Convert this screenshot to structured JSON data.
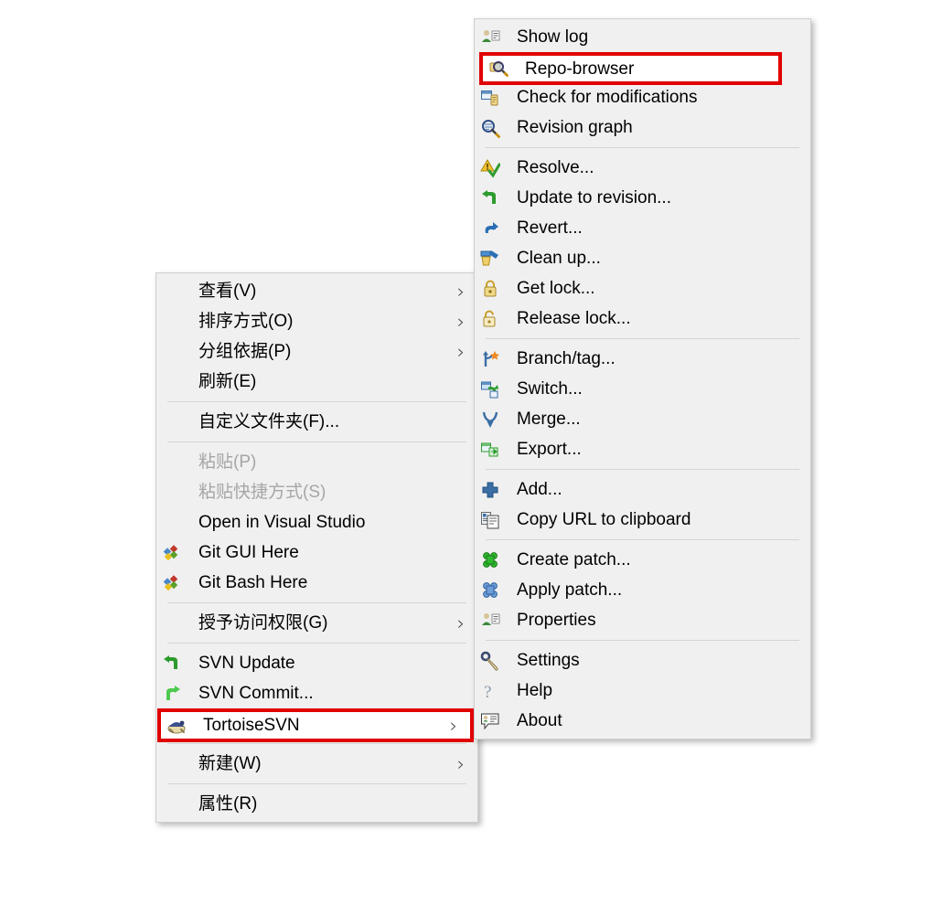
{
  "explorer_context_menu": {
    "name": "Windows Explorer context menu",
    "groups": [
      {
        "items": [
          {
            "label": "查看(V)",
            "icon": "none",
            "submenu": true,
            "disabled": false
          },
          {
            "label": "排序方式(O)",
            "icon": "none",
            "submenu": true,
            "disabled": false
          },
          {
            "label": "分组依据(P)",
            "icon": "none",
            "submenu": true,
            "disabled": false
          },
          {
            "label": "刷新(E)",
            "icon": "none",
            "submenu": false,
            "disabled": false
          }
        ]
      },
      {
        "items": [
          {
            "label": "自定义文件夹(F)...",
            "icon": "none",
            "submenu": false,
            "disabled": false
          }
        ]
      },
      {
        "items": [
          {
            "label": "粘贴(P)",
            "icon": "none",
            "submenu": false,
            "disabled": true
          },
          {
            "label": "粘贴快捷方式(S)",
            "icon": "none",
            "submenu": false,
            "disabled": true
          },
          {
            "label": "Open in Visual Studio",
            "icon": "none",
            "submenu": false,
            "disabled": false
          },
          {
            "label": "Git GUI Here",
            "icon": "git-icon",
            "submenu": false,
            "disabled": false
          },
          {
            "label": "Git Bash Here",
            "icon": "git-icon",
            "submenu": false,
            "disabled": false
          }
        ]
      },
      {
        "items": [
          {
            "label": "授予访问权限(G)",
            "icon": "none",
            "submenu": true,
            "disabled": false
          }
        ]
      },
      {
        "items": [
          {
            "label": "SVN Update",
            "icon": "svn-update-icon",
            "submenu": false,
            "disabled": false
          },
          {
            "label": "SVN Commit...",
            "icon": "svn-commit-icon",
            "submenu": false,
            "disabled": false
          },
          {
            "label": "TortoiseSVN",
            "icon": "tortoise-icon",
            "submenu": true,
            "disabled": false,
            "highlighted": true
          }
        ]
      },
      {
        "items": [
          {
            "label": "新建(W)",
            "icon": "none",
            "submenu": true,
            "disabled": false
          }
        ]
      },
      {
        "items": [
          {
            "label": "属性(R)",
            "icon": "none",
            "submenu": false,
            "disabled": false
          }
        ]
      }
    ]
  },
  "tortoisesvn_submenu": {
    "name": "TortoiseSVN submenu",
    "groups": [
      {
        "items": [
          {
            "label": "Show log",
            "icon": "show-log-icon"
          },
          {
            "label": "Repo-browser",
            "icon": "repo-browser-icon",
            "highlighted": true
          },
          {
            "label": "Check for modifications",
            "icon": "check-modifications-icon"
          },
          {
            "label": "Revision graph",
            "icon": "revision-graph-icon"
          }
        ]
      },
      {
        "items": [
          {
            "label": "Resolve...",
            "icon": "resolve-icon"
          },
          {
            "label": "Update to revision...",
            "icon": "update-revision-icon"
          },
          {
            "label": "Revert...",
            "icon": "revert-icon"
          },
          {
            "label": "Clean up...",
            "icon": "cleanup-icon"
          },
          {
            "label": "Get lock...",
            "icon": "get-lock-icon"
          },
          {
            "label": "Release lock...",
            "icon": "release-lock-icon"
          }
        ]
      },
      {
        "items": [
          {
            "label": "Branch/tag...",
            "icon": "branch-tag-icon"
          },
          {
            "label": "Switch...",
            "icon": "switch-icon"
          },
          {
            "label": "Merge...",
            "icon": "merge-icon"
          },
          {
            "label": "Export...",
            "icon": "export-icon"
          }
        ]
      },
      {
        "items": [
          {
            "label": "Add...",
            "icon": "add-icon"
          },
          {
            "label": "Copy URL to clipboard",
            "icon": "copy-url-icon"
          }
        ]
      },
      {
        "items": [
          {
            "label": "Create patch...",
            "icon": "create-patch-icon"
          },
          {
            "label": "Apply patch...",
            "icon": "apply-patch-icon"
          },
          {
            "label": "Properties",
            "icon": "properties-icon"
          }
        ]
      },
      {
        "items": [
          {
            "label": "Settings",
            "icon": "settings-icon"
          },
          {
            "label": "Help",
            "icon": "help-icon"
          },
          {
            "label": "About",
            "icon": "about-icon"
          }
        ]
      }
    ]
  },
  "highlights": [
    {
      "target": "Repo-browser",
      "color": "#e00000"
    },
    {
      "target": "TortoiseSVN",
      "color": "#e00000"
    }
  ],
  "colors": {
    "menu_background": "#f0f0f0",
    "menu_border": "#cfcfcf",
    "separator": "#d4d4d4",
    "text": "#000000",
    "disabled_text": "#a6a6a6",
    "highlight_border": "#e00000",
    "highlight_fill": "#ffffff"
  },
  "submenu_arrow_glyph": "›"
}
